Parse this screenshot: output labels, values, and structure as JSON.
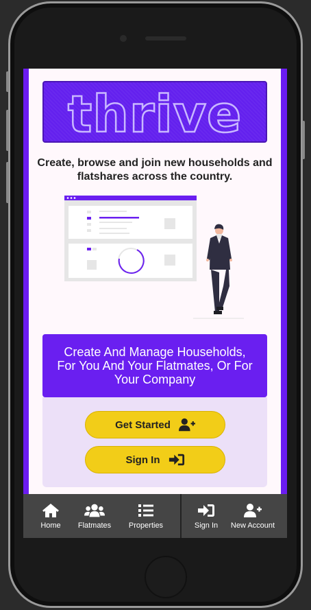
{
  "app": {
    "logo_text": "thrive",
    "tagline": "Create, browse and join new households and flatshares across the country."
  },
  "cta": {
    "heading": "Create And Manage Households, For You And Your Flatmates, Or For Your Company",
    "get_started_label": "Get Started",
    "sign_in_label": "Sign In",
    "get_started_icon": "user-plus-icon",
    "sign_in_icon": "sign-in-icon"
  },
  "nav": {
    "items": [
      {
        "label": "Home",
        "icon": "home-icon"
      },
      {
        "label": "Flatmates",
        "icon": "users-icon"
      },
      {
        "label": "Properties",
        "icon": "list-icon"
      },
      {
        "label": "Sign In",
        "icon": "sign-in-icon"
      },
      {
        "label": "New Account",
        "icon": "user-plus-icon"
      }
    ]
  },
  "colors": {
    "brand_purple": "#6a1ff0",
    "accent_yellow": "#f2cd18",
    "nav_bg": "#454545"
  }
}
